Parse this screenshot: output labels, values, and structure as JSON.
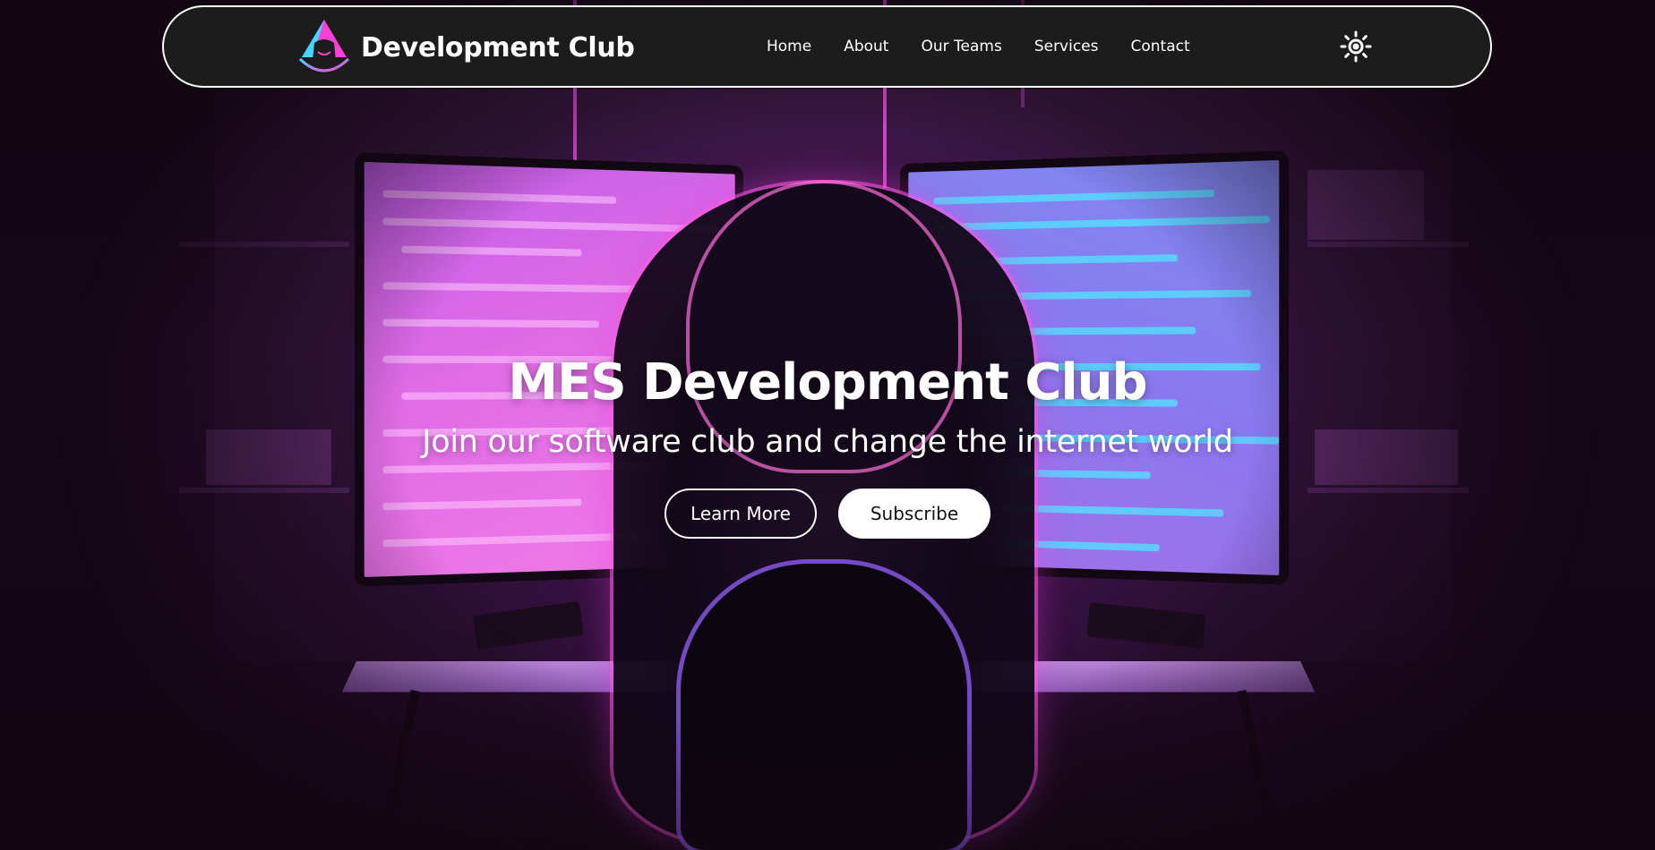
{
  "navbar": {
    "brand_name": "Development Club",
    "logo_icon": "hooded-hacker-logo-icon",
    "links": [
      {
        "label": "Home"
      },
      {
        "label": "About"
      },
      {
        "label": "Our Teams"
      },
      {
        "label": "Services"
      },
      {
        "label": "Contact"
      }
    ],
    "theme_toggle_icon": "sun-icon"
  },
  "hero": {
    "title": "MES Development Club",
    "subtitle": "Join our software club and change the internet world",
    "buttons": {
      "learn_more": "Learn More",
      "subscribe": "Subscribe"
    },
    "background": "hooded-hacker-at-desk-illustration"
  },
  "colors": {
    "navbar_bg": "#1c1c1c",
    "navbar_border": "#ffffff",
    "accent_pink": "#e040e0",
    "accent_cyan": "#40e0ff",
    "text": "#ffffff"
  }
}
